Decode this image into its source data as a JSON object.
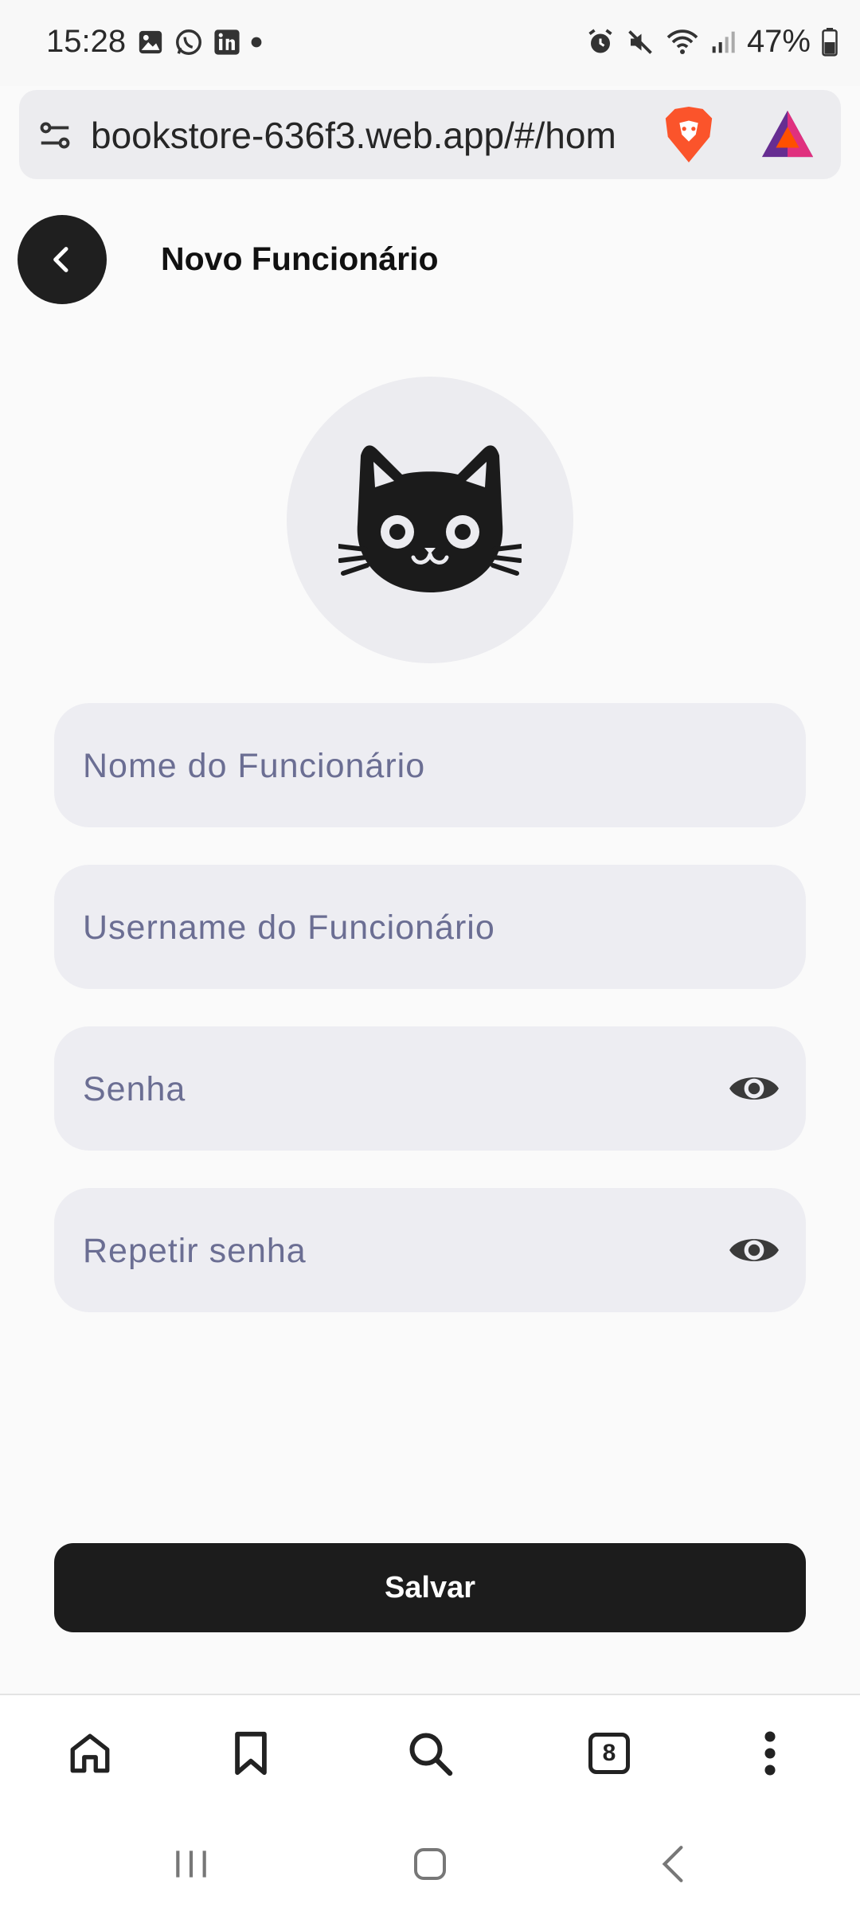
{
  "status_bar": {
    "time": "15:28",
    "battery": "47%",
    "left_icons": [
      "gallery-icon",
      "whatsapp-icon",
      "linkedin-icon",
      "dot-icon"
    ],
    "right_icons": [
      "alarm-icon",
      "mute-icon",
      "wifi-icon",
      "signal-icon",
      "battery-icon"
    ]
  },
  "browser": {
    "url": "bookstore-636f3.web.app/#/hom",
    "tab_count": "8"
  },
  "header": {
    "title": "Novo Funcionário"
  },
  "form": {
    "name_placeholder": "Nome do Funcionário",
    "username_placeholder": "Username do Funcionário",
    "password_placeholder": "Senha",
    "repeat_password_placeholder": "Repetir senha"
  },
  "actions": {
    "save_label": "Salvar"
  },
  "colors": {
    "accent": "#1c1c1c",
    "field_bg": "#ededf2",
    "placeholder": "#6b6e93"
  }
}
